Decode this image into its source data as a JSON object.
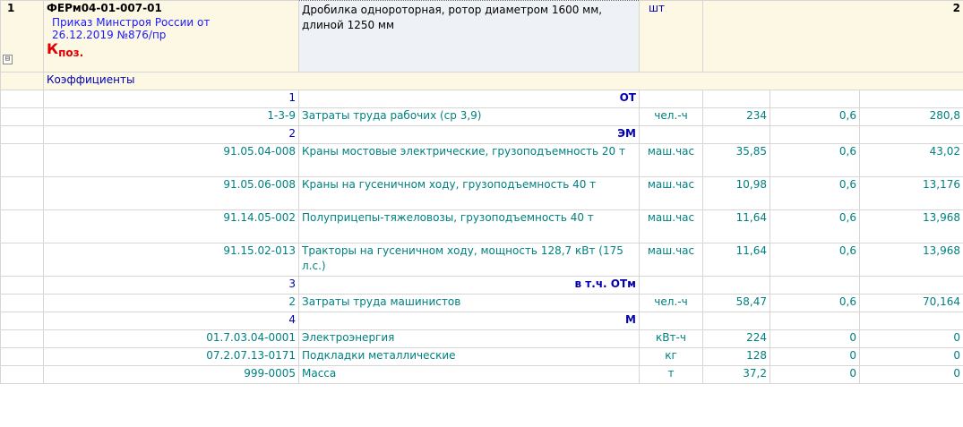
{
  "position": {
    "number": "1",
    "code": "ФЕРм04-01-007-01",
    "order_line1": "Приказ Минстроя России от",
    "order_line2": "26.12.2019 №876/пр",
    "k_main": "К",
    "k_sub": "поз.",
    "description": "Дробилка однороторная, ротор диаметром 1600 мм, длиной 1250 мм",
    "unit": "шт",
    "quantity": "2",
    "collapse_glyph": "⊟"
  },
  "coefficients_label": "Коэффициенты",
  "rows": [
    {
      "kind": "section",
      "index": "1",
      "label": "ОТ"
    },
    {
      "kind": "item",
      "code": "1-3-9",
      "name": "Затраты труда рабочих (ср 3,9)",
      "unit": "чел.-ч",
      "value": "234",
      "coef": "0,6",
      "total": "280,8"
    },
    {
      "kind": "section",
      "index": "2",
      "label": "ЭМ"
    },
    {
      "kind": "item",
      "wrap": true,
      "code": "91.05.04-008",
      "name": "Краны мостовые электрические, грузоподъемность 20 т",
      "unit": "маш.час",
      "value": "35,85",
      "coef": "0,6",
      "total": "43,02"
    },
    {
      "kind": "item",
      "wrap": true,
      "code": "91.05.06-008",
      "name": "Краны на гусеничном ходу, грузоподъемность 40 т",
      "unit": "маш.час",
      "value": "10,98",
      "coef": "0,6",
      "total": "13,176"
    },
    {
      "kind": "item",
      "wrap": true,
      "code": "91.14.05-002",
      "name": "Полуприцепы-тяжеловозы, грузоподъемность 40 т",
      "unit": "маш.час",
      "value": "11,64",
      "coef": "0,6",
      "total": "13,968"
    },
    {
      "kind": "item",
      "wrap": true,
      "code": "91.15.02-013",
      "name": "Тракторы на гусеничном ходу, мощность 128,7 кВт (175 л.с.)",
      "unit": "маш.час",
      "value": "11,64",
      "coef": "0,6",
      "total": "13,968"
    },
    {
      "kind": "section",
      "index": "3",
      "label": "в т.ч. ОТм"
    },
    {
      "kind": "item",
      "code": "2",
      "name": "Затраты труда машинистов",
      "unit": "чел.-ч",
      "value": "58,47",
      "coef": "0,6",
      "total": "70,164"
    },
    {
      "kind": "section",
      "index": "4",
      "label": "М"
    },
    {
      "kind": "item",
      "code": "01.7.03.04-0001",
      "name": "Электроэнергия",
      "unit": "кВт-ч",
      "value": "224",
      "coef": "0",
      "total": "0"
    },
    {
      "kind": "item",
      "code": "07.2.07.13-0171",
      "name": "Подкладки металлические",
      "unit": "кг",
      "value": "128",
      "coef": "0",
      "total": "0"
    },
    {
      "kind": "item",
      "code": "999-0005",
      "name": "Масса",
      "unit": "т",
      "value": "37,2",
      "coef": "0",
      "total": "0"
    }
  ]
}
